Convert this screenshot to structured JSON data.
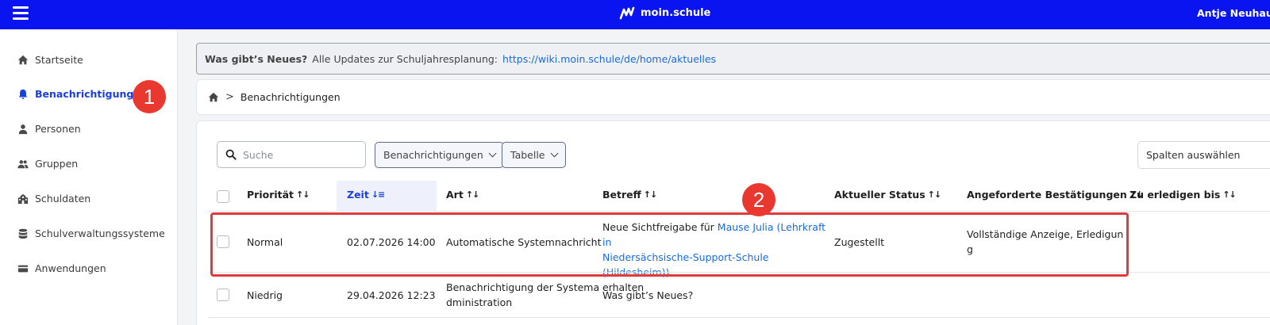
{
  "app": {
    "brand": "moin.schule",
    "user_name": "Antje Neuhaus-S"
  },
  "sidebar": {
    "items": [
      {
        "label": "Startseite",
        "icon": "home-icon"
      },
      {
        "label": "Benachrichtigungen",
        "icon": "bell-icon",
        "active": true
      },
      {
        "label": "Personen",
        "icon": "person-icon"
      },
      {
        "label": "Gruppen",
        "icon": "group-icon"
      },
      {
        "label": "Schuldaten",
        "icon": "school-icon"
      },
      {
        "label": "Schulverwaltungssysteme",
        "icon": "database-icon"
      },
      {
        "label": "Anwendungen",
        "icon": "card-icon"
      }
    ]
  },
  "markers": [
    "1",
    "2"
  ],
  "banner": {
    "title": "Was gibt’s Neues?",
    "text": "Alle Updates zur Schuljahresplanung:",
    "link": "https://wiki.moin.schule/de/home/aktuelles"
  },
  "breadcrumb": {
    "current": "Benachrichtigungen"
  },
  "toolbar": {
    "search_placeholder": "Suche",
    "filter_label": "Benachrichtigungen",
    "view_label": "Tabelle",
    "columns_label": "Spalten auswählen"
  },
  "table": {
    "columns": [
      "Priorität",
      "Zeit",
      "Art",
      "Betreff",
      "Aktueller Status",
      "Angeforderte Bestätigungen",
      "Zu erledigen bis"
    ],
    "sorted_column": "Zeit",
    "rows": [
      {
        "priority": "Normal",
        "time": "02.07.2026 14:00",
        "type": "Automatische Systemnachricht",
        "subject_prefix": "Neue Sichtfreigabe für ",
        "subject_link_line1": "Mause Julia (Lehrkraft in",
        "subject_link_line2": "Niedersächsische-Support-Schule (Hildesheim))",
        "subject_suffix": "erhalten",
        "status": "Zugestellt",
        "confirmations_line1": "Vollständige Anzeige, Erledigun",
        "confirmations_line2": "g",
        "due": ""
      },
      {
        "priority": "Niedrig",
        "time": "29.04.2026 12:23",
        "type_line1": "Benachrichtigung der Systema",
        "type_line2": "dministration",
        "subject": "Was gibt’s Neues?",
        "status": "",
        "confirmations": "",
        "due": ""
      }
    ]
  },
  "colors": {
    "topbar": "#0a14f0",
    "accent": "#1a3fe0",
    "link": "#1a6be0",
    "marker": "#e8382f",
    "highlight": "#e03a3f"
  }
}
